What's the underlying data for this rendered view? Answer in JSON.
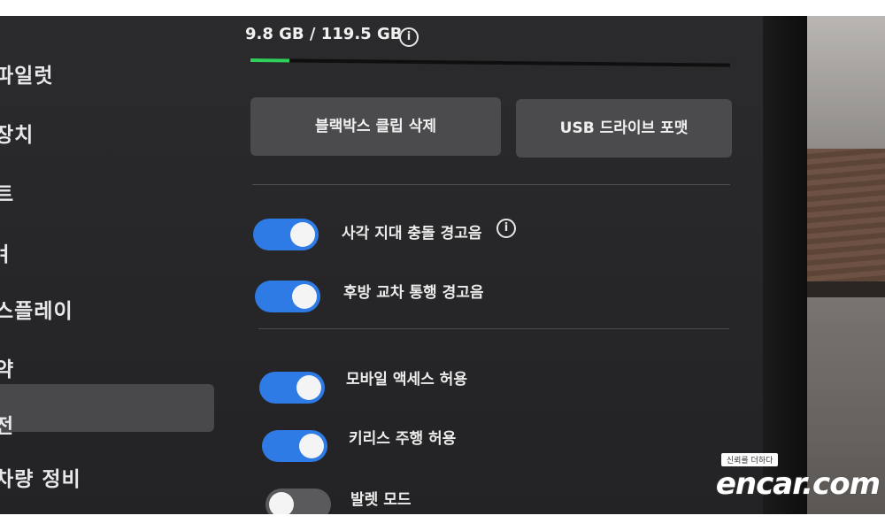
{
  "nav": {
    "items": [
      {
        "label": "파일럿"
      },
      {
        "label": "장치"
      },
      {
        "label": "트"
      },
      {
        "label": "ㅕ"
      },
      {
        "label": "스플레이"
      },
      {
        "label": "약"
      },
      {
        "label": "전"
      },
      {
        "label": "차량 정비"
      }
    ],
    "selected_index": 6
  },
  "storage": {
    "text": "9.8 GB / 119.5 GB",
    "used_gb": 9.8,
    "total_gb": 119.5,
    "info_icon": "info-icon",
    "bar_color": "#2fd05a"
  },
  "buttons": {
    "delete_clips": "블랙박스 클립 삭제",
    "format_usb": "USB 드라이브 포맷"
  },
  "toggles": [
    {
      "label": "사각 지대 충돌 경고음",
      "on": true,
      "has_info": true
    },
    {
      "label": "후방 교차 통행 경고음",
      "on": true,
      "has_info": false
    },
    {
      "label": "모바일 액세스 허용",
      "on": true,
      "has_info": false
    },
    {
      "label": "키리스 주행 허용",
      "on": true,
      "has_info": false
    },
    {
      "label": "발렛 모드",
      "on": false,
      "has_info": false
    }
  ],
  "colors": {
    "toggle_on": "#2f7be6",
    "toggle_off": "#5a5a5c",
    "screen_bg": "#2b2b2d"
  },
  "watermark": {
    "tagline": "신뢰를 더하다",
    "brand": "encar.com"
  }
}
